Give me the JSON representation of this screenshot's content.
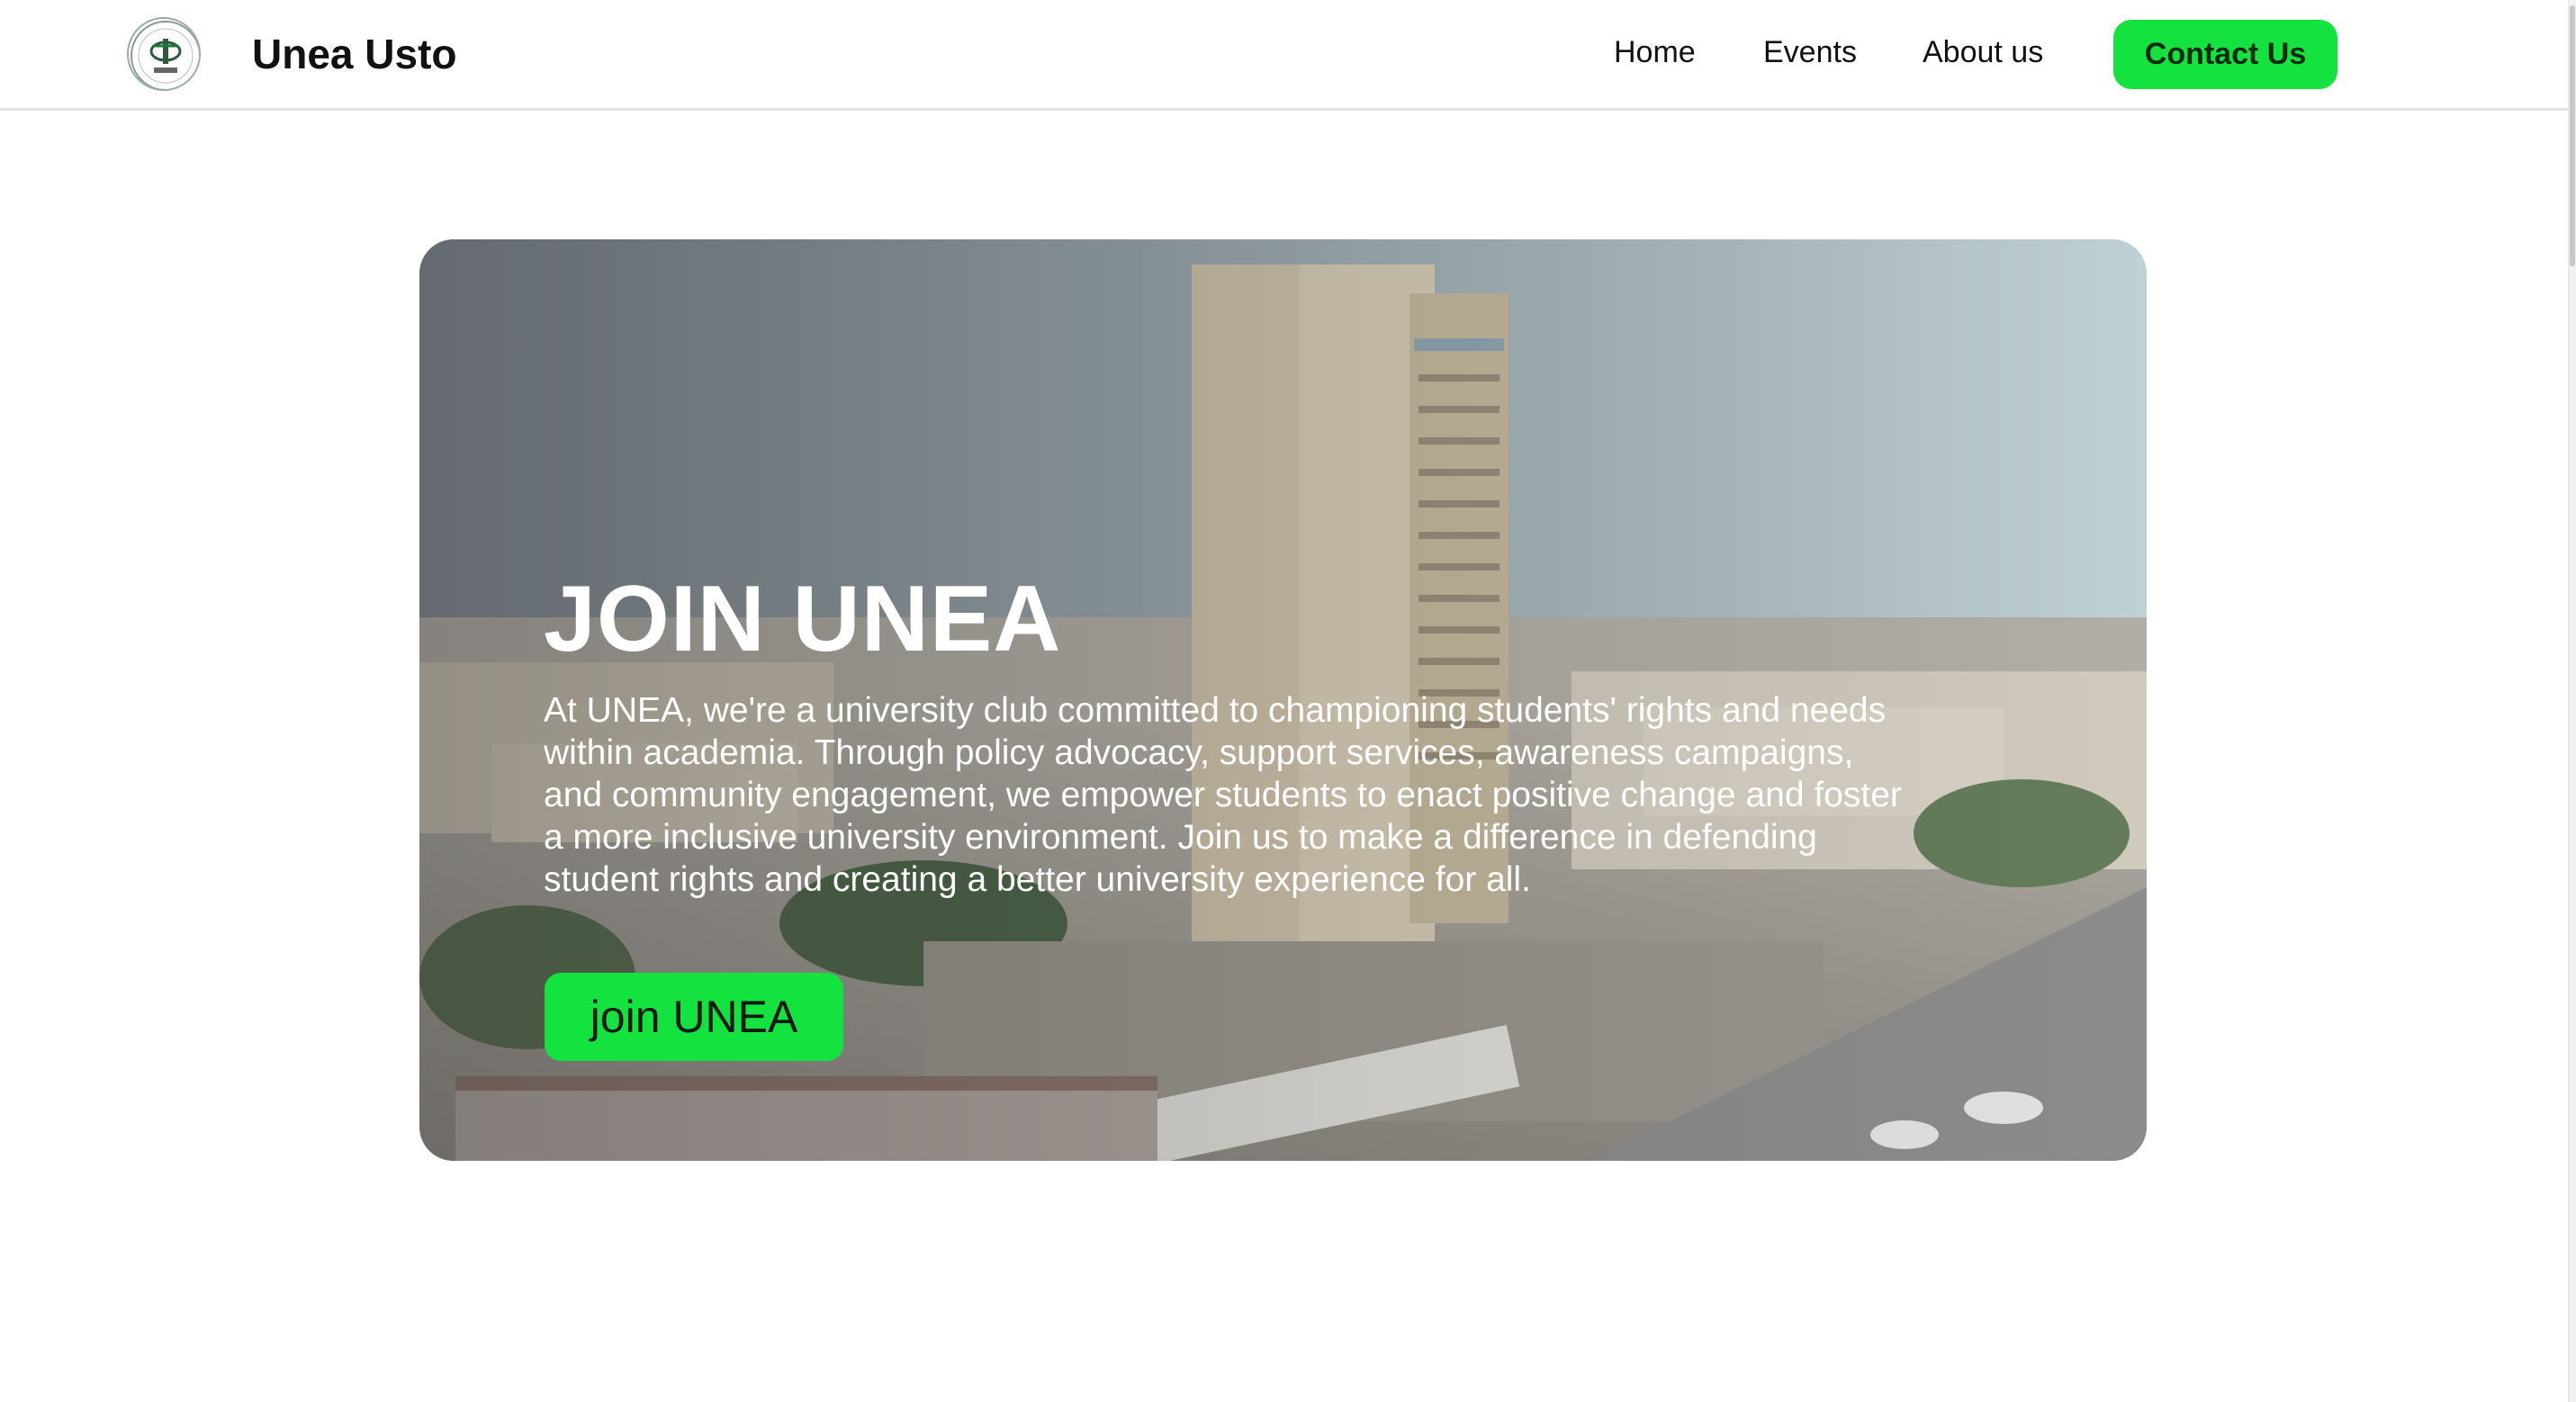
{
  "header": {
    "logo_icon": "unea-seal-logo",
    "brand": "Unea Usto",
    "nav": {
      "home": "Home",
      "events": "Events",
      "about": "About us"
    },
    "contact_label": "Contact Us"
  },
  "hero": {
    "background": "campus-building-photo",
    "title": "JOIN UNEA",
    "text": "At UNEA, we're a university club committed to championing students' rights and needs within academia. Through policy advocacy, support services, awareness campaigns, and community engagement, we empower students to enact positive change and foster a more inclusive university environment. Join us to make a difference in defending student rights and creating a better university experience for all.",
    "button_label": "join UNEA"
  },
  "colors": {
    "accent": "#14e33f",
    "header_border": "#e4e4e4"
  }
}
